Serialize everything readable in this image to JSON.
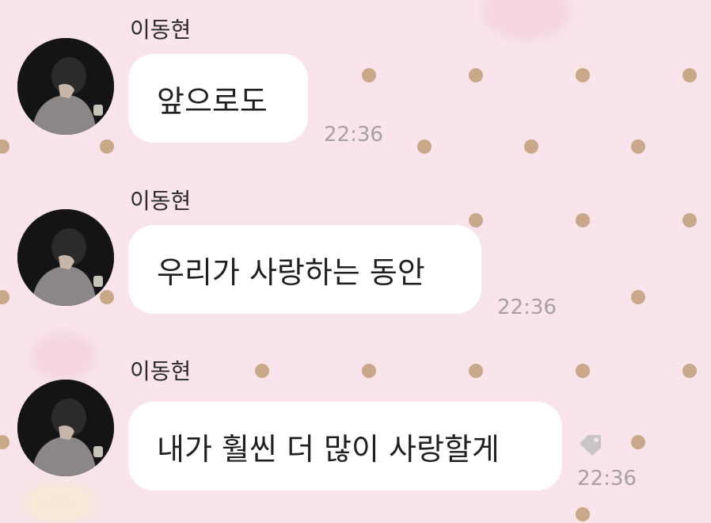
{
  "chat": {
    "messages": [
      {
        "sender": "이동현",
        "text": "앞으로도",
        "time": "22:36",
        "avatar_icon": "profile-photo"
      },
      {
        "sender": "이동현",
        "text": "우리가 사랑하는 동안",
        "time": "22:36",
        "avatar_icon": "profile-photo"
      },
      {
        "sender": "이동현",
        "text": "내가 훨씬 더 많이 사랑할게",
        "time": "22:36",
        "avatar_icon": "profile-photo",
        "extra_icon": "tag-icon"
      }
    ]
  },
  "theme": {
    "background": "#f8e4ea",
    "dot_color": "#c9a889",
    "bubble_color": "#ffffff",
    "time_color": "#a6a0a3"
  }
}
